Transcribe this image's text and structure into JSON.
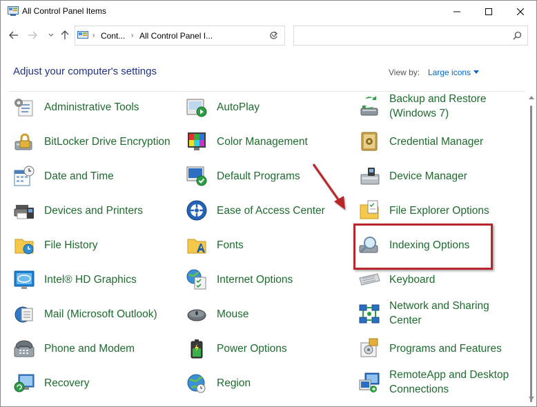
{
  "window": {
    "title": "All Control Panel Items",
    "controls": {
      "minimize": "minimize-icon",
      "maximize": "maximize-icon",
      "close": "close-icon"
    }
  },
  "address": {
    "crumbs": [
      "Cont...",
      "All Control Panel I..."
    ],
    "search_placeholder": ""
  },
  "header": {
    "title": "Adjust your computer's settings",
    "view_by_label": "View by:",
    "view_by_value": "Large icons"
  },
  "items": {
    "col0": [
      {
        "label": "Administrative Tools",
        "icon": "administrative-tools-icon"
      },
      {
        "label": "BitLocker Drive Encryption",
        "icon": "bitlocker-icon"
      },
      {
        "label": "Date and Time",
        "icon": "date-time-icon"
      },
      {
        "label": "Devices and Printers",
        "icon": "devices-printers-icon"
      },
      {
        "label": "File History",
        "icon": "file-history-icon"
      },
      {
        "label": "Intel® HD Graphics",
        "icon": "intel-graphics-icon"
      },
      {
        "label": "Mail (Microsoft Outlook)",
        "icon": "mail-icon"
      },
      {
        "label": "Phone and Modem",
        "icon": "phone-modem-icon"
      },
      {
        "label": "Recovery",
        "icon": "recovery-icon"
      }
    ],
    "col1": [
      {
        "label": "AutoPlay",
        "icon": "autoplay-icon"
      },
      {
        "label": "Color Management",
        "icon": "color-management-icon"
      },
      {
        "label": "Default Programs",
        "icon": "default-programs-icon"
      },
      {
        "label": "Ease of Access Center",
        "icon": "ease-of-access-icon"
      },
      {
        "label": "Fonts",
        "icon": "fonts-icon"
      },
      {
        "label": "Internet Options",
        "icon": "internet-options-icon"
      },
      {
        "label": "Mouse",
        "icon": "mouse-icon"
      },
      {
        "label": "Power Options",
        "icon": "power-options-icon"
      },
      {
        "label": "Region",
        "icon": "region-icon"
      }
    ],
    "col2": [
      {
        "label1": "Backup and Restore",
        "label2": "(Windows 7)",
        "icon": "backup-restore-icon"
      },
      {
        "label": "Credential Manager",
        "icon": "credential-manager-icon"
      },
      {
        "label": "Device Manager",
        "icon": "device-manager-icon"
      },
      {
        "label": "File Explorer Options",
        "icon": "file-explorer-options-icon"
      },
      {
        "label": "Indexing Options",
        "icon": "indexing-options-icon"
      },
      {
        "label": "Keyboard",
        "icon": "keyboard-icon"
      },
      {
        "label1": "Network and Sharing",
        "label2": "Center",
        "icon": "network-sharing-icon"
      },
      {
        "label": "Programs and Features",
        "icon": "programs-features-icon"
      },
      {
        "label1": "RemoteApp and Desktop",
        "label2": "Connections",
        "icon": "remoteapp-icon"
      }
    ]
  },
  "colors": {
    "link_green": "#1e6b2e",
    "heading_blue": "#1e3287",
    "accent_blue": "#0066cc",
    "highlight_red": "#b8252a"
  }
}
